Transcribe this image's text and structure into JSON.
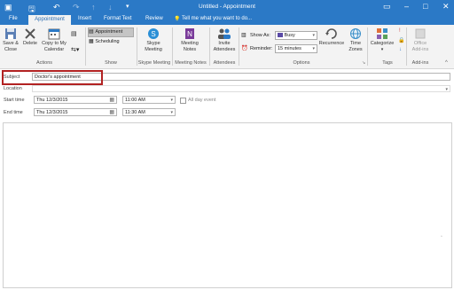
{
  "titlebar": {
    "title": "Untitled - Appointment"
  },
  "tabs": [
    {
      "label": "File"
    },
    {
      "label": "Appointment"
    },
    {
      "label": "Insert"
    },
    {
      "label": "Format Text"
    },
    {
      "label": "Review"
    }
  ],
  "tell_me": "Tell me what you want to do...",
  "ribbon": {
    "actions": {
      "save_close_1": "Save &",
      "save_close_2": "Close",
      "delete": "Delete",
      "copy_1": "Copy to My",
      "copy_2": "Calendar",
      "group": "Actions"
    },
    "show": {
      "appointment": "Appointment",
      "scheduling": "Scheduling",
      "group": "Show"
    },
    "skype": {
      "label_1": "Skype",
      "label_2": "Meeting",
      "group": "Skype Meeting"
    },
    "notes": {
      "label_1": "Meeting",
      "label_2": "Notes",
      "group": "Meeting Notes"
    },
    "attendees": {
      "label_1": "Invite",
      "label_2": "Attendees",
      "group": "Attendees"
    },
    "options": {
      "show_as_label": "Show As:",
      "show_as_value": "Busy",
      "reminder_label": "Reminder:",
      "reminder_value": "15 minutes",
      "recurrence": "Recurrence",
      "time_zones_1": "Time",
      "time_zones_2": "Zones",
      "group": "Options"
    },
    "tags": {
      "categorize": "Categorize",
      "group": "Tags"
    },
    "addins": {
      "label_1": "Office",
      "label_2": "Add-ins",
      "group": "Add-ins"
    }
  },
  "form": {
    "subject_label": "Subject",
    "subject_value": "Doctor's appointment",
    "location_label": "Location",
    "start_label": "Start time",
    "start_date": "Thu 12/3/2015",
    "start_time": "11:00 AM",
    "end_label": "End time",
    "end_date": "Thu 12/3/2015",
    "end_time": "11:30 AM",
    "all_day": "All day event"
  },
  "colors": {
    "accent": "#2b79c6",
    "highlight_box": "#b22222",
    "busy_swatch": "#5a4aa6"
  }
}
